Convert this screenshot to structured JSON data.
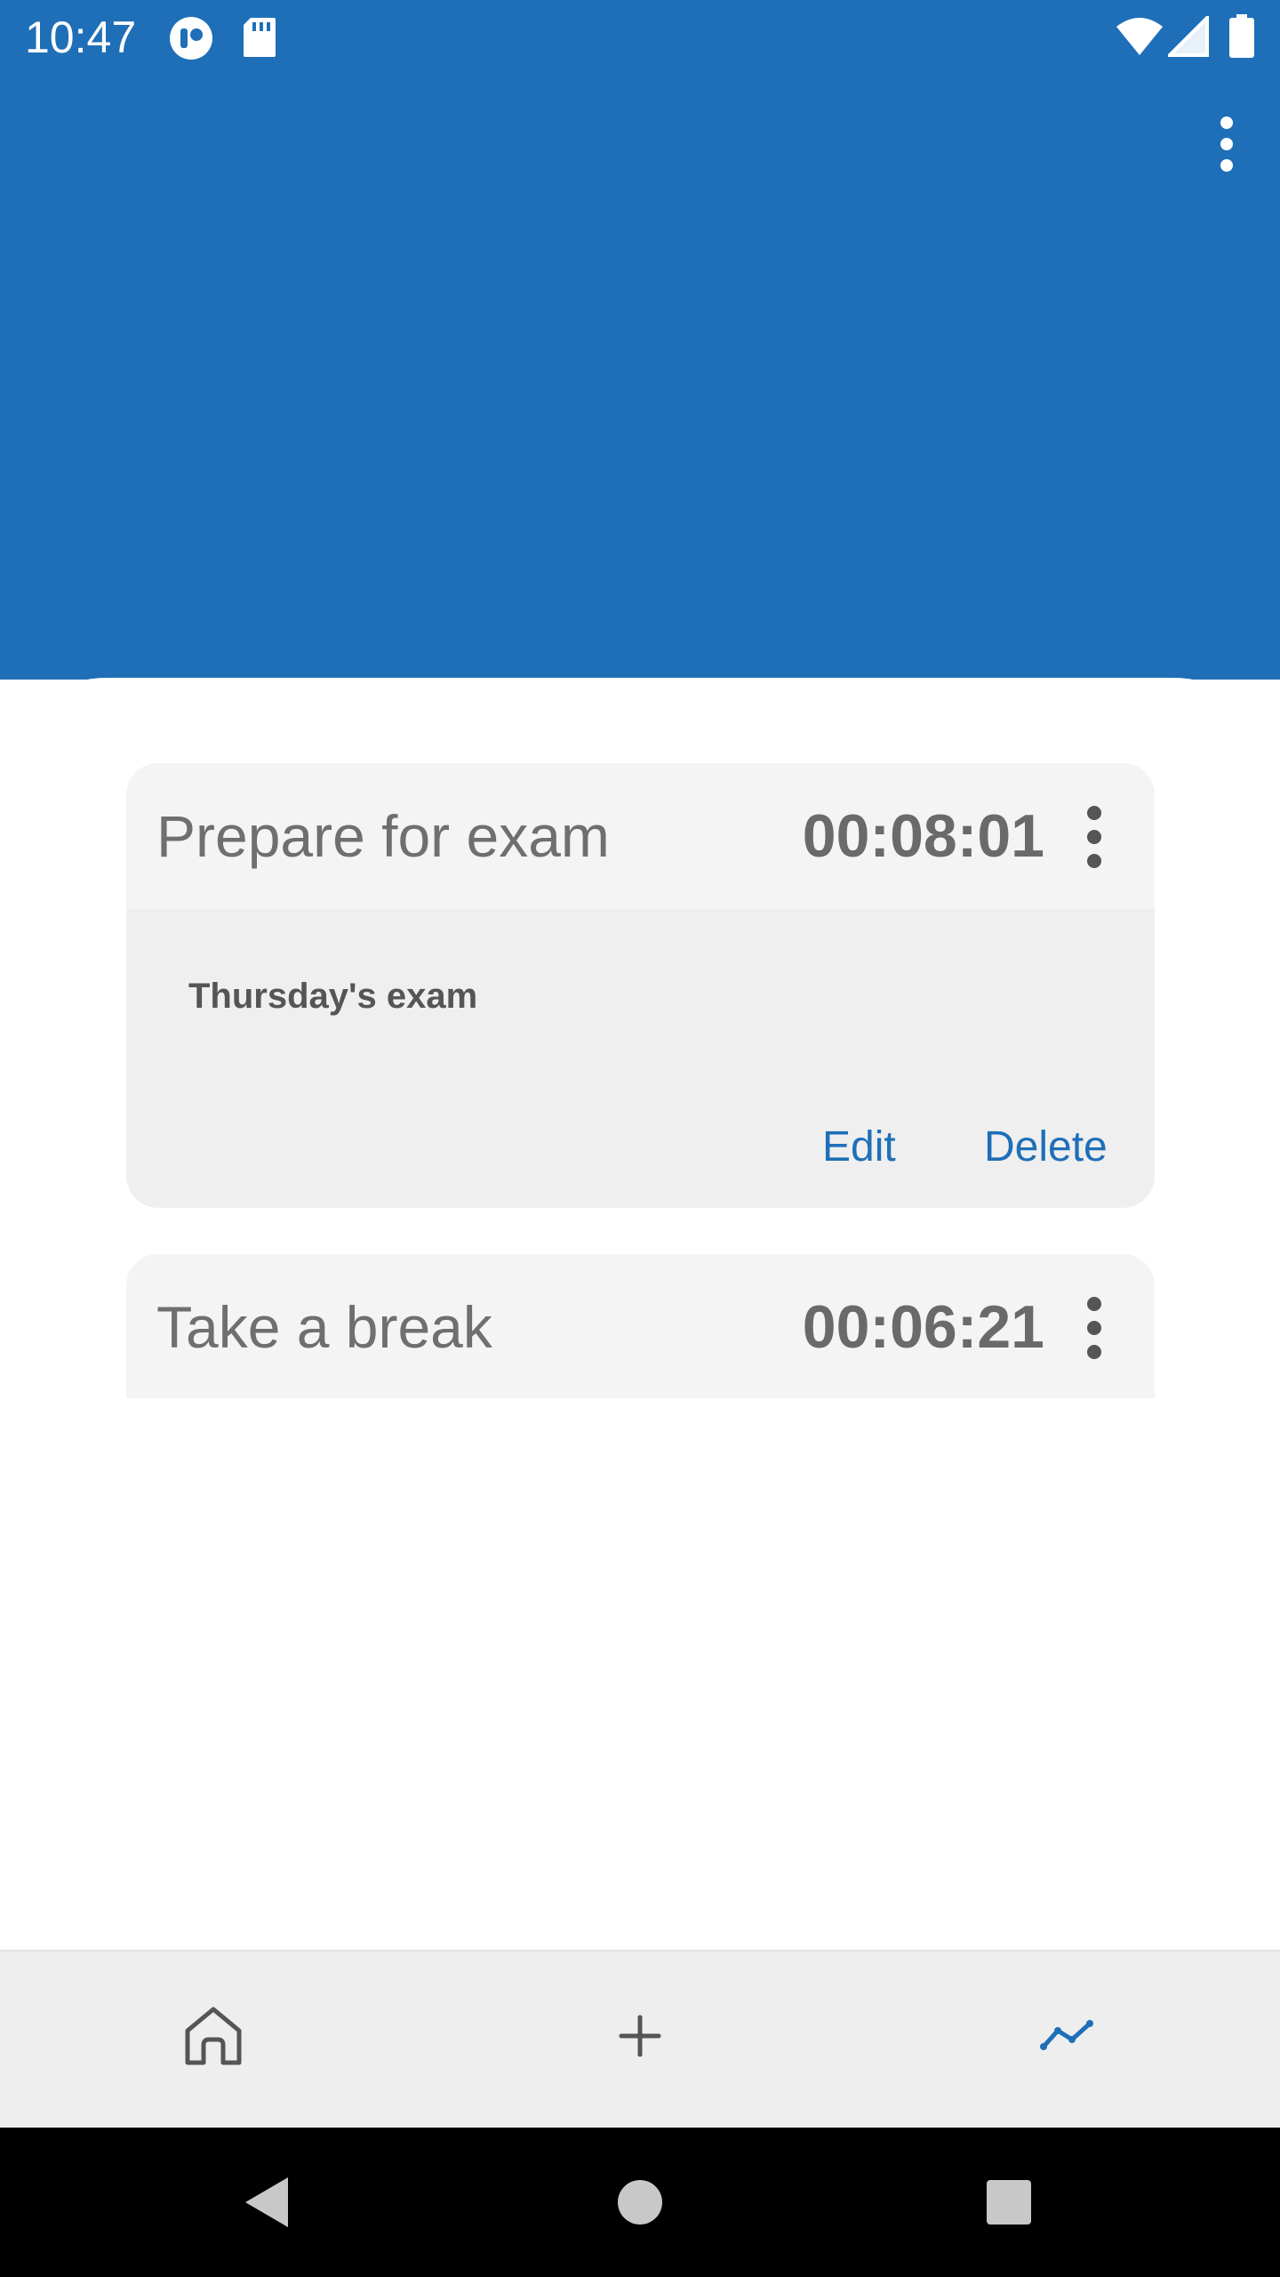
{
  "status_bar": {
    "time": "10:47",
    "left_icons": [
      "app-notification-icon",
      "sd-card-icon"
    ],
    "right_icons": [
      "wifi-icon",
      "cell-signal-icon",
      "battery-icon"
    ]
  },
  "header": {
    "background_color": "#1e6fb8",
    "overflow_icon": "more-vert-icon"
  },
  "timers": [
    {
      "title": "Prepare for exam",
      "time": "00:08:01",
      "note": "Thursday's exam",
      "expanded": true,
      "actions": {
        "edit": "Edit",
        "delete": "Delete"
      }
    },
    {
      "title": "Take a break",
      "time": "00:06:21",
      "expanded": false
    }
  ],
  "bottom_nav": {
    "items": [
      {
        "icon": "home-icon",
        "active": false
      },
      {
        "icon": "add-icon",
        "active": false
      },
      {
        "icon": "stats-icon",
        "active": true
      }
    ],
    "active_color": "#1e6fb8",
    "inactive_color": "#555555"
  },
  "system_nav": [
    "back-icon",
    "home-circle-icon",
    "recents-icon"
  ],
  "colors": {
    "accent": "#1e6fb8",
    "card_background": "#efefef",
    "card_header_background": "#f4f4f4"
  }
}
